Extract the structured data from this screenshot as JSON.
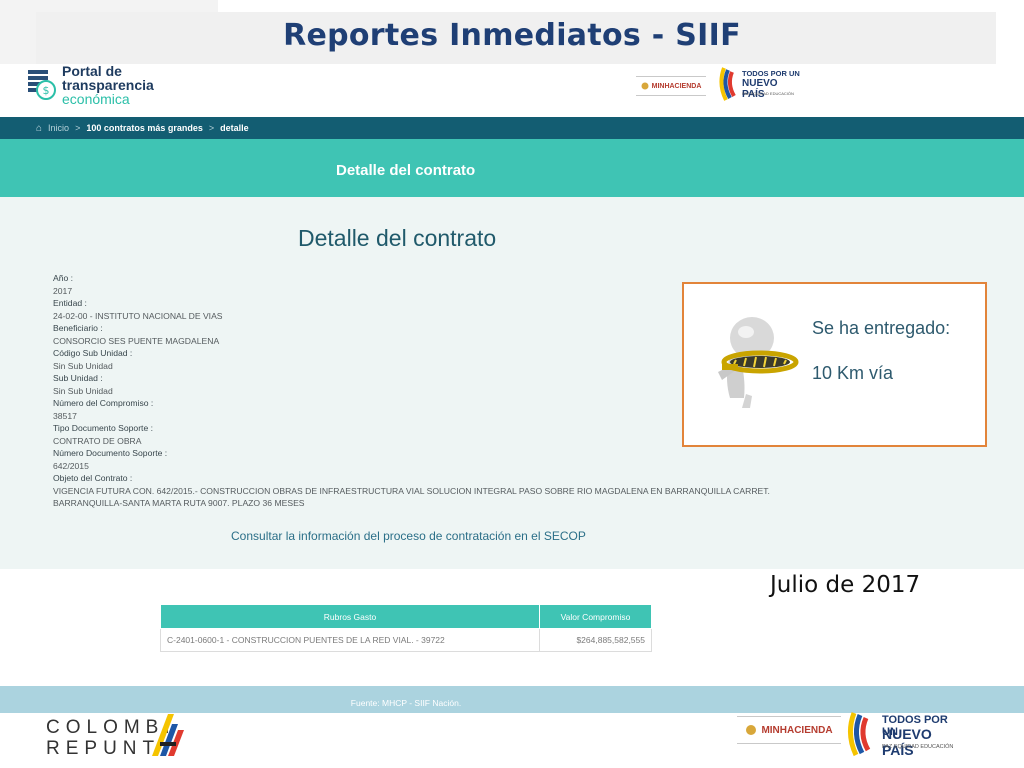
{
  "slide": {
    "title": "Reportes Inmediatos - SIIF",
    "date": "Julio de 2017",
    "bottom_logo": {
      "line1": "COLOMBI",
      "line2": "REPUNT"
    }
  },
  "portal": {
    "logo_line1": "Portal de",
    "logo_line2": "transparencia",
    "logo_line3": "económica",
    "minhacienda_label": "MINHACIENDA",
    "todos_line1": "TODOS POR UN",
    "todos_line2": "NUEVO PAÍS",
    "todos_line3": "PAZ  EQUIDAD  EDUCACIÓN"
  },
  "breadcrumb": [
    "Inicio",
    "100 contratos más grandes",
    "detalle"
  ],
  "band_title": "Detalle del contrato",
  "page_heading": "Detalle del contrato",
  "fields": [
    {
      "label": "Año :",
      "value": "2017"
    },
    {
      "label": "Entidad :",
      "value": "24-02-00 - INSTITUTO NACIONAL DE VIAS"
    },
    {
      "label": "Beneficiario :",
      "value": "CONSORCIO SES PUENTE MAGDALENA"
    },
    {
      "label": "Código Sub Unidad :",
      "value": "Sin Sub Unidad"
    },
    {
      "label": "Sub Unidad :",
      "value": "Sin Sub Unidad"
    },
    {
      "label": "Número del Compromiso :",
      "value": "38517"
    },
    {
      "label": "Tipo Documento Soporte :",
      "value": "CONTRATO DE OBRA"
    },
    {
      "label": "Número Documento Soporte :",
      "value": "642/2015"
    },
    {
      "label": "Objeto del Contrato :",
      "value": "VIGENCIA FUTURA CON. 642/2015.- CONSTRUCCION OBRAS DE INFRAESTRUCTURA VIAL SOLUCION INTEGRAL PASO SOBRE RIO MAGDALENA EN BARRANQUILLA CARRET. BARRANQUILLA-SANTA MARTA RUTA 9007. PLAZO 36 MESES"
    }
  ],
  "secop_link": "Consultar la información del proceso de contratación en el SECOP",
  "callout": {
    "line1": "Se ha entregado:",
    "line2": "10 Km vía"
  },
  "table": {
    "headers": [
      "Rubros Gasto",
      "Valor Compromiso"
    ],
    "rows": [
      [
        "C-2401-0600-1 - CONSTRUCCION PUENTES DE LA RED VIAL. - 39722",
        "$264,885,582,555"
      ]
    ]
  },
  "footer_source": "Fuente: MHCP - SIIF Nación.",
  "colors": {
    "teal": "#3fc4b4",
    "dark_teal": "#135d72",
    "title_blue": "#1f3f75",
    "callout_border": "#e2843a"
  }
}
